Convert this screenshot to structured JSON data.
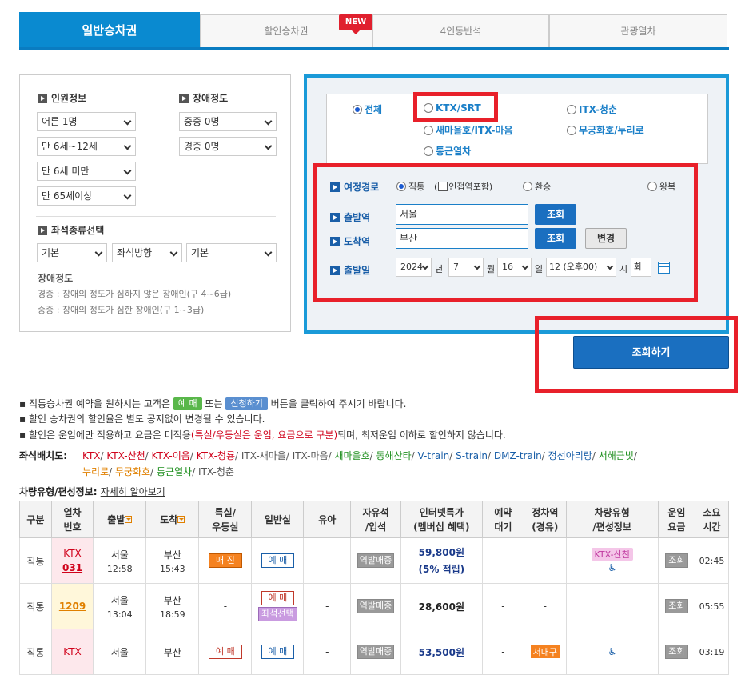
{
  "tabs": [
    "일반승차권",
    "할인승차권",
    "4인동반석",
    "관광열차"
  ],
  "new_badge": "NEW",
  "left": {
    "passenger_title": "인원정보",
    "disability_title": "장애정도",
    "selects_left": [
      "어른 1명",
      "만 6세~12세",
      "만 6세 미만",
      "만 65세이상"
    ],
    "selects_right": [
      "중증 0명",
      "경증 0명"
    ],
    "seat_title": "좌석종류선택",
    "seat_selects": [
      "기본",
      "좌석방향",
      "기본"
    ],
    "notes_title": "장애정도",
    "note1": "경증 : 장애의 정도가 심하지 않은 장애인(구 4~6급)",
    "note2": "중증 : 장애의 정도가 심한 장애인(구 1~3급)"
  },
  "right": {
    "radios": [
      "전체",
      "KTX/SRT",
      "ITX-청춘",
      "새마을호/ITX-마음",
      "무궁화호/누리로",
      "통근열차"
    ],
    "route_label": "여정경로",
    "route_opts": [
      "직통",
      "(",
      "인접역포함)",
      "환승",
      "왕복"
    ],
    "dep_label": "출발역",
    "arr_label": "도착역",
    "date_label": "출발일",
    "dep_value": "서울",
    "arr_value": "부산",
    "lookup": "조회",
    "change": "변경",
    "year": "2024",
    "year_unit": "년",
    "month": "7",
    "month_unit": "월",
    "day": "16",
    "day_unit": "일",
    "hour": "12 (오후00)",
    "hour_unit": "시",
    "weekday": "화"
  },
  "search_button": "조회하기",
  "info": {
    "l1a": "직통승차권 예약을 원하시는 고객은",
    "l1_pill1": "예 매",
    "l1b": "또는",
    "l1_pill2": "신청하기",
    "l1c": "버튼을 클릭하여 주시기 바랍니다.",
    "l2": "할인 승차권의 할인율은 별도 공지없이 변경될 수 있습니다.",
    "l3a": "할인은 운임에만 적용하고 요금은 미적용",
    "l3b": "(특실/우등실은 운임, 요금으로 구분)",
    "l3c": "되며, 최저운임 이하로 할인하지 않습니다."
  },
  "seat_map": {
    "label": "좌석배치도:",
    "line1": [
      {
        "t": "KTX",
        "c": "red"
      },
      {
        "t": "/ ",
        "c": "gray"
      },
      {
        "t": "KTX-산천",
        "c": "red"
      },
      {
        "t": "/ ",
        "c": "gray"
      },
      {
        "t": "KTX-이음",
        "c": "red"
      },
      {
        "t": "/ ",
        "c": "gray"
      },
      {
        "t": "KTX-청룡",
        "c": "red"
      },
      {
        "t": "/ ",
        "c": "gray"
      },
      {
        "t": "ITX-새마을",
        "c": "gray"
      },
      {
        "t": "/ ",
        "c": "gray"
      },
      {
        "t": "ITX-마음",
        "c": "gray"
      },
      {
        "t": "/ ",
        "c": "gray"
      },
      {
        "t": "새마을호",
        "c": "grn"
      },
      {
        "t": "/ ",
        "c": "gray"
      },
      {
        "t": "동해산타",
        "c": "grn"
      },
      {
        "t": "/ ",
        "c": "gray"
      },
      {
        "t": "V-train",
        "c": "blu"
      },
      {
        "t": "/ ",
        "c": "gray"
      },
      {
        "t": "S-train",
        "c": "blu"
      },
      {
        "t": "/ ",
        "c": "gray"
      },
      {
        "t": "DMZ-train",
        "c": "blu"
      },
      {
        "t": "/ ",
        "c": "gray"
      },
      {
        "t": "정선아리랑",
        "c": "blu"
      },
      {
        "t": "/ ",
        "c": "gray"
      },
      {
        "t": "서해금빛",
        "c": "grn"
      },
      {
        "t": "/",
        "c": "gray"
      }
    ],
    "line2": [
      {
        "t": "누리로",
        "c": "org"
      },
      {
        "t": "/ ",
        "c": "gray"
      },
      {
        "t": "무궁화호",
        "c": "org"
      },
      {
        "t": "/ ",
        "c": "gray"
      },
      {
        "t": "통근열차",
        "c": "grn"
      },
      {
        "t": "/ ",
        "c": "gray"
      },
      {
        "t": "ITX-청춘",
        "c": "gray"
      }
    ]
  },
  "formation": {
    "label": "차량유형/편성정보:",
    "link": "자세히 알아보기"
  },
  "table": {
    "headers": [
      "구분",
      "열차\n번호",
      "출발",
      "도착",
      "특실/\n우등실",
      "일반실",
      "유아",
      "자유석\n/입석",
      "인터넷특가\n(멤버십 혜택)",
      "예약\n대기",
      "정차역\n(경유)",
      "차량유형\n/편성정보",
      "운임\n요금",
      "소요\n시간"
    ],
    "rows": [
      {
        "type": "직통",
        "train": "KTX",
        "num": "031",
        "dep": "서울",
        "dep_t": "12:58",
        "arr": "부산",
        "arr_t": "15:43",
        "special": "매 진",
        "normal": "예 매",
        "infant": "-",
        "free": "역발매중",
        "price": "59,800원",
        "benefit": "(5% 적립)",
        "wait": "-",
        "stops": "-",
        "vehicle": "KTX-산천",
        "fare": "조회",
        "time": "02:45"
      },
      {
        "type": "직통",
        "train": "",
        "num": "1209",
        "dep": "서울",
        "dep_t": "13:04",
        "arr": "부산",
        "arr_t": "18:59",
        "special": "-",
        "normal": "예 매",
        "normal2": "좌석선택",
        "infant": "-",
        "free": "역발매중",
        "price": "28,600원",
        "benefit": "",
        "wait": "-",
        "stops": "-",
        "vehicle": "",
        "fare": "조회",
        "time": "05:55"
      },
      {
        "type": "직통",
        "train": "KTX",
        "num": "",
        "dep": "서울",
        "dep_t": "",
        "arr": "부산",
        "arr_t": "",
        "special": "예 매",
        "normal": "예 매",
        "infant": "-",
        "free": "역발매중",
        "price": "53,500원",
        "benefit": "",
        "wait": "-",
        "stops": "서대구",
        "vehicle": "",
        "fare": "조회",
        "time": "03:19"
      }
    ]
  },
  "colors": {
    "accent": "#0a8ad0",
    "red_outline": "#e8202a",
    "button_blue": "#1a6fc0"
  }
}
